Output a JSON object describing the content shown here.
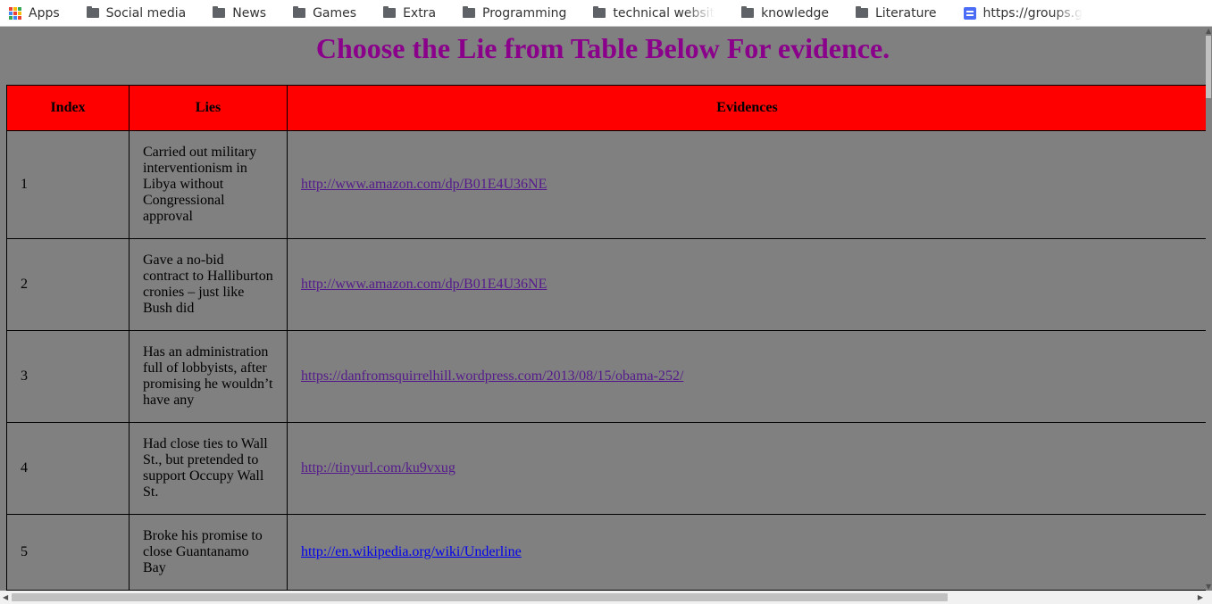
{
  "bookmarks": {
    "apps": "Apps",
    "items": [
      "Social media",
      "News",
      "Games",
      "Extra",
      "Programming",
      "technical websit",
      "knowledge",
      "Literature"
    ],
    "groups_url": "https://groups.g"
  },
  "page": {
    "title": "Choose the Lie from Table Below For evidence."
  },
  "table": {
    "headers": [
      "Index",
      "Lies",
      "Evidences"
    ],
    "rows": [
      {
        "index": "1",
        "lie": "Carried out military interventionism in Libya without Congressional approval",
        "evidence": "http://www.amazon.com/dp/B01E4U36NE"
      },
      {
        "index": "2",
        "lie": "Gave a no-bid contract to Halliburton cronies – just like Bush did",
        "evidence": "http://www.amazon.com/dp/B01E4U36NE"
      },
      {
        "index": "3",
        "lie": "Has an administration full of lobbyists, after promising he wouldn’t have any",
        "evidence": "https://danfromsquirrelhill.wordpress.com/2013/08/15/obama-252/"
      },
      {
        "index": "4",
        "lie": "Had close ties to Wall St., but pretended to support Occupy Wall St.",
        "evidence": "http://tinyurl.com/ku9vxug"
      },
      {
        "index": "5",
        "lie": "Broke his promise to close Guantanamo Bay",
        "evidence": "http://en.wikipedia.org/wiki/Underline"
      }
    ]
  },
  "colors": {
    "header_bg": "#ff0000",
    "title": "#8b008b",
    "page_bg": "#808080",
    "visited_link": "#551a8b",
    "link": "#0000ee"
  }
}
